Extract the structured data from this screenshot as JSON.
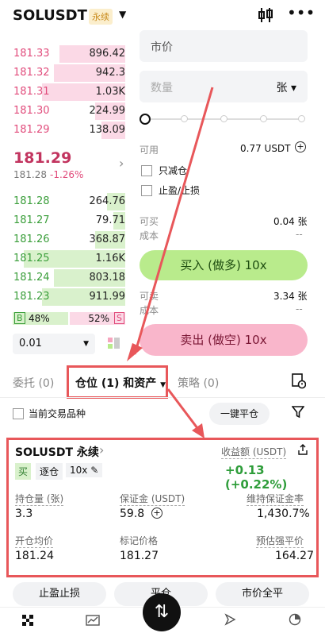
{
  "header": {
    "symbol": "SOLUSDT",
    "badge": "永续"
  },
  "order_book": {
    "asks": [
      {
        "price": "181.33",
        "qty": "896.42",
        "depth": 0.55
      },
      {
        "price": "181.32",
        "qty": "942.3",
        "depth": 0.6
      },
      {
        "price": "181.31",
        "qty": "1.03K",
        "depth": 0.7
      },
      {
        "price": "181.30",
        "qty": "224.99",
        "depth": 0.25
      },
      {
        "price": "181.29",
        "qty": "138.09",
        "depth": 0.2
      }
    ],
    "last_price": "181.29",
    "mark_price": "181.28",
    "change": "-1.26%",
    "bids": [
      {
        "price": "181.28",
        "qty": "264.76",
        "depth": 0.15
      },
      {
        "price": "181.27",
        "qty": "79.71",
        "depth": 0.1
      },
      {
        "price": "181.26",
        "qty": "368.87",
        "depth": 0.25
      },
      {
        "price": "181.25",
        "qty": "1.16K",
        "depth": 0.85
      },
      {
        "price": "181.24",
        "qty": "803.18",
        "depth": 0.6
      },
      {
        "price": "181.23",
        "qty": "911.99",
        "depth": 0.7
      }
    ],
    "buy_ratio": "48%",
    "sell_ratio": "52%",
    "b_label": "B",
    "s_label": "S",
    "precision": "0.01"
  },
  "order_panel": {
    "price_type": "市价",
    "qty_placeholder": "数量",
    "unit": "张",
    "available_label": "可用",
    "available_value": "0.77 USDT",
    "reduce_only": "只减仓",
    "tp_sl": "止盈/止损",
    "can_buy_label": "可买",
    "can_buy_value": "0.04 张",
    "cost_label": "成本",
    "cost_value": "--",
    "buy_button": "买入 (做多) 10x",
    "can_sell_label": "可卖",
    "can_sell_value": "3.34 张",
    "cost2_label": "成本",
    "cost2_value": "--",
    "sell_button": "卖出 (做空) 10x"
  },
  "tabs": [
    {
      "label": "委托 (0)"
    },
    {
      "label": "仓位 (1) 和资产"
    },
    {
      "label": "策略 (0)"
    }
  ],
  "filter": {
    "current_only": "当前交易品种",
    "close_all": "一键平仓"
  },
  "position": {
    "symbol": "SOLUSDT 永续",
    "side": "买",
    "margin_mode": "逐仓",
    "leverage": "10x",
    "pnl_label": "收益额 (USDT)",
    "pnl_value": "+0.13 (+0.22%)",
    "qty_label": "持仓量 (张)",
    "qty_value": "3.3",
    "margin_label": "保证金 (USDT)",
    "margin_value": "59.8",
    "maint_label": "维持保证金率",
    "maint_value": "1,430.7%",
    "entry_label": "开仓均价",
    "entry_value": "181.24",
    "mark_label": "标记价格",
    "mark_value": "181.27",
    "liq_label": "预估强平价",
    "liq_value": "164.27"
  },
  "actions": {
    "tp_sl": "止盈止损",
    "close": "平仓",
    "market_close": "市价全平"
  },
  "colors": {
    "buy": "#b9eb8c",
    "sell": "#f9b6cb",
    "highlight": "#e8575a",
    "profit": "#2e9d3a",
    "loss": "#e14b7b"
  }
}
